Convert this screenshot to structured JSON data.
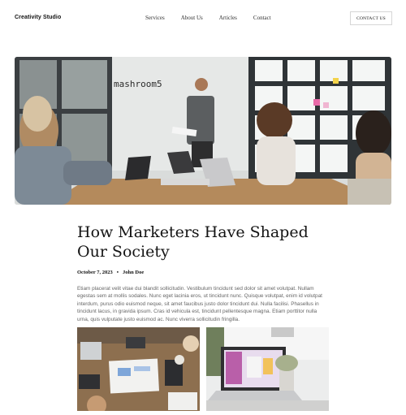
{
  "header": {
    "brand": "Creativity Studio",
    "nav": [
      "Services",
      "About Us",
      "Articles",
      "Contact"
    ],
    "cta_label": "CONTACT US"
  },
  "hero": {
    "wall_text": "mashroom5",
    "icon": "office-meeting-photo"
  },
  "article": {
    "title": "How Marketers Have Shaped Our Society",
    "date": "October 7, 2023",
    "separator": "•",
    "author": "John Doe",
    "body": "Etiam placerat velit vitae dui blandit sollicitudin. Vestibulum tincidunt sed dolor sit amet volutpat. Nullam egestas sem at mollis sodales. Nunc eget lacinia eros, ut tincidunt nunc. Quisque volutpat, enim id volutpat interdum, purus odio euismod neque, sit amet faucibus justo dolor tincidunt dui. Nulla facilisi. Phasellus in tincidunt lacus, in gravida ipsum. Cras id vehicula est, tincidunt pellentesque magna. Etiam porttitor nulla urna, quis vulputate justo euismod ac. Nunc viverra sollicitudin fringilla."
  },
  "thumbnails": [
    {
      "icon": "desk-top-view-photo"
    },
    {
      "icon": "laptop-workspace-photo"
    }
  ]
}
